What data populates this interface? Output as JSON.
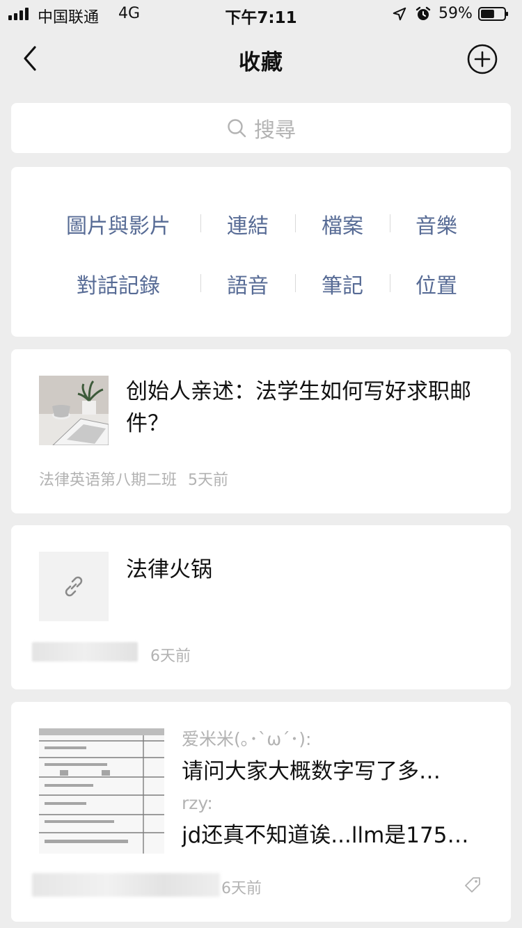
{
  "status_bar": {
    "carrier": "中国联通",
    "network": "4G",
    "time": "下午7:11",
    "battery_percent": "59%",
    "battery_level": 0.59,
    "icons": [
      "signal-icon",
      "location-arrow-icon",
      "alarm-clock-icon",
      "battery-icon"
    ]
  },
  "nav": {
    "title": "收藏",
    "back_icon": "chevron-left-icon",
    "add_icon": "plus-circle-icon"
  },
  "search": {
    "placeholder": "搜尋",
    "icon": "search-icon"
  },
  "categories": {
    "row1": [
      "圖片與影片",
      "連結",
      "檔案",
      "音樂"
    ],
    "row2": [
      "對話記錄",
      "語音",
      "筆記",
      "位置"
    ]
  },
  "favorites": [
    {
      "title": "创始人亲述：法学生如何写好求职邮件？",
      "source": "法律英语第八期二班",
      "time": "5天前",
      "thumbnail": "laptop-photo"
    },
    {
      "title": "法律火锅",
      "time": "6天前",
      "thumbnail_icon": "link-icon"
    },
    {
      "messages": [
        {
          "speaker": "爱米米(｡･`ω´･):",
          "text": "请问大家大概数字写了多…"
        },
        {
          "speaker": "rzy:",
          "text": "jd还真不知道诶...llm是175…"
        }
      ],
      "time": "6天前",
      "thumbnail": "document-scan",
      "tag_icon": "tag-icon"
    }
  ],
  "colors": {
    "background": "#ededed",
    "category_text": "#576b95",
    "meta_text": "#b2b2b2"
  }
}
